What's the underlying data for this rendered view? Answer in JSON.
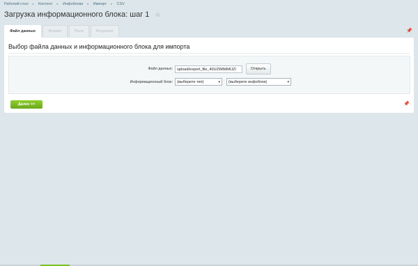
{
  "breadcrumb": [
    "Рабочий стол",
    "Контент",
    "Инфоблоки",
    "Импорт",
    "CSV"
  ],
  "title": "Загрузка информационного блока: шаг 1",
  "tabs": [
    "Файл данных",
    "Формат",
    "Поля",
    "Результат"
  ],
  "panel": {
    "title": "Выбор файла данных и информационного блока для импорта",
    "file_label": "Файл данных:",
    "file_value": "upload/export_file_40UZW8dMIJZl",
    "open_button": "Открыть",
    "iblock_label": "Информационный блок:",
    "type_select": "(выберите тип)",
    "iblock_select": "(выберите инфоблок)"
  },
  "next_button": "Далее >>",
  "colors": {
    "accent": "#7bbf22",
    "background": "#dde6ea"
  }
}
